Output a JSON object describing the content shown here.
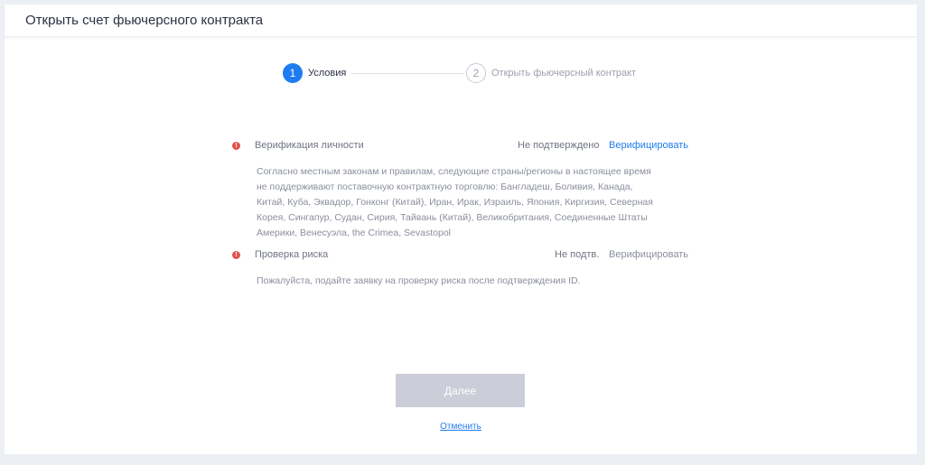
{
  "header": {
    "title": "Открыть счет фьючерсного контракта"
  },
  "stepper": {
    "steps": [
      {
        "number": "1",
        "label": "Условия",
        "active": true
      },
      {
        "number": "2",
        "label": "Открыть фьючерсный контракт",
        "active": false
      }
    ]
  },
  "sections": {
    "identity": {
      "title": "Верификация личности",
      "status": "Не подтверждено",
      "action": "Верифицировать",
      "description": "Согласно местным законам и правилам, следующие страны/регионы в настоящее время не поддерживают поставочную контрактную торговлю: Бангладеш, Боливия, Канада, Китай, Куба, Эквадор, Гонконг (Китай), Иран, Ирак, Израиль, Япония, Киргизия, Северная Корея, Сингапур, Судан, Сирия, Тайвань (Китай), Великобритания, Соединенные Штаты Америки, Венесуэла, the Crimea, Sevastopol"
    },
    "risk": {
      "title": "Проверка риска",
      "status": "Не подтв.",
      "action": "Верифицировать",
      "description": "Пожалуйста, подайте заявку на проверку риска после подтверждения ID."
    }
  },
  "buttons": {
    "next": "Далее",
    "cancel": "Отменить"
  },
  "colors": {
    "accent": "#1f7cf0",
    "warning": "#e3524e",
    "disabled_button": "#cbced8"
  }
}
